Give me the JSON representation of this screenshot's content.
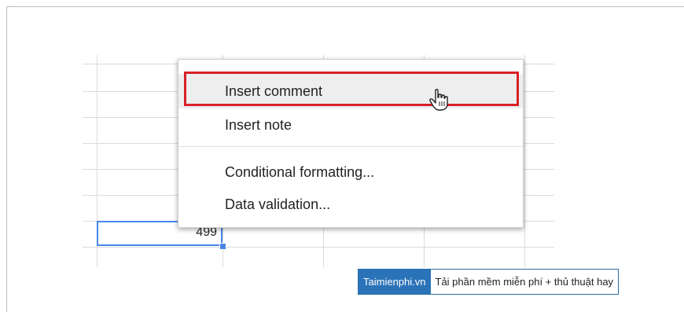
{
  "sheet": {
    "selected_cell_value": "499"
  },
  "context_menu": {
    "items": [
      {
        "label": "Insert comment",
        "highlighted": true
      },
      {
        "label": "Insert note"
      },
      {
        "label": "Conditional formatting..."
      },
      {
        "label": "Data validation..."
      }
    ]
  },
  "watermark": {
    "brand": "Taimienphi.vn",
    "tagline": "Tải phần mềm miễn phí + thủ thuật hay"
  },
  "colors": {
    "selection": "#4a86e8",
    "highlight_box": "#d92027",
    "watermark_brand": "#2b73b8"
  }
}
